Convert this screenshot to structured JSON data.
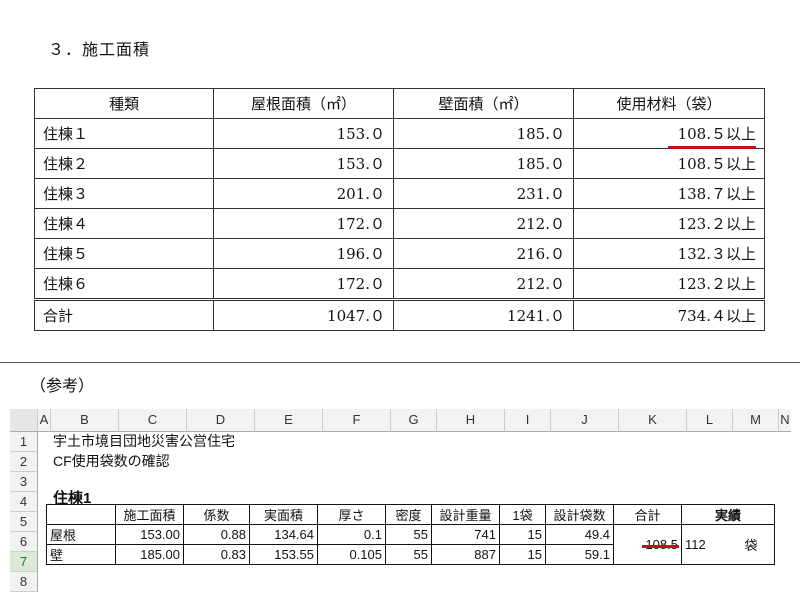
{
  "section_title": "３．施工面積",
  "table": {
    "headers": [
      "種類",
      "屋根面積（㎡）",
      "壁面積（㎡）",
      "使用材料（袋）"
    ],
    "rows": [
      [
        "住棟１",
        "153.０",
        "185.０",
        "108.５以上"
      ],
      [
        "住棟２",
        "153.０",
        "185.０",
        "108.５以上"
      ],
      [
        "住棟３",
        "201.０",
        "231.０",
        "138.７以上"
      ],
      [
        "住棟４",
        "172.０",
        "212.０",
        "123.２以上"
      ],
      [
        "住棟５",
        "196.０",
        "216.０",
        "132.３以上"
      ],
      [
        "住棟６",
        "172.０",
        "212.０",
        "123.２以上"
      ]
    ],
    "total": [
      "合計",
      "1047.０",
      "1241.０",
      "734.４以上"
    ]
  },
  "reference_title": "（参考）",
  "sheet": {
    "columns": [
      "A",
      "B",
      "C",
      "D",
      "E",
      "F",
      "G",
      "H",
      "I",
      "J",
      "K",
      "L",
      "M",
      "N"
    ],
    "rows": [
      "1",
      "2",
      "3",
      "4",
      "5",
      "6",
      "7",
      "8"
    ],
    "line1": "宇土市境目団地災害公営住宅",
    "line2": "CF使用袋数の確認",
    "heading": "住棟1",
    "grid_headers": [
      "",
      "施工面積",
      "係数",
      "実面積",
      "厚さ",
      "密度",
      "設計重量",
      "1袋",
      "設計袋数",
      "合計",
      "実績"
    ],
    "grid_rows": [
      [
        "屋根",
        "153.00",
        "0.88",
        "134.64",
        "0.1",
        "55",
        "741",
        "15",
        "49.4"
      ],
      [
        "壁",
        "185.00",
        "0.83",
        "153.55",
        "0.105",
        "55",
        "887",
        "15",
        "59.1"
      ]
    ],
    "total": "108.5",
    "actual": "112",
    "actual_unit": "袋"
  }
}
